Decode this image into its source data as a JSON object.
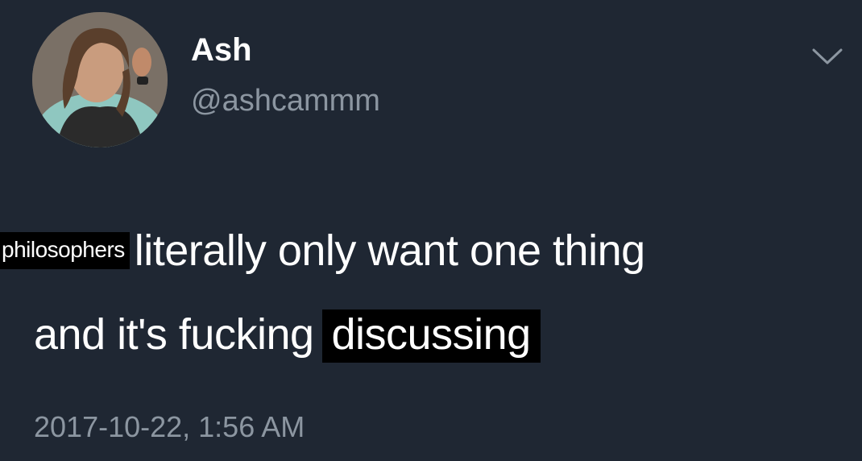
{
  "tweet": {
    "display_name": "Ash",
    "handle": "@ashcammm",
    "text_line1_sticker": "philosophers",
    "text_line1": "literally only want one thing",
    "text_line2": "and it's fucking",
    "text_line2_sticker": "discussing",
    "timestamp": "2017-10-22, 1:56 AM"
  },
  "icons": {
    "avatar": "avatar-photo",
    "menu": "chevron-down-icon"
  },
  "colors": {
    "background": "#1f2733",
    "primary_text": "#ffffff",
    "secondary_text": "#8c96a1",
    "sticker_background": "#000000"
  }
}
